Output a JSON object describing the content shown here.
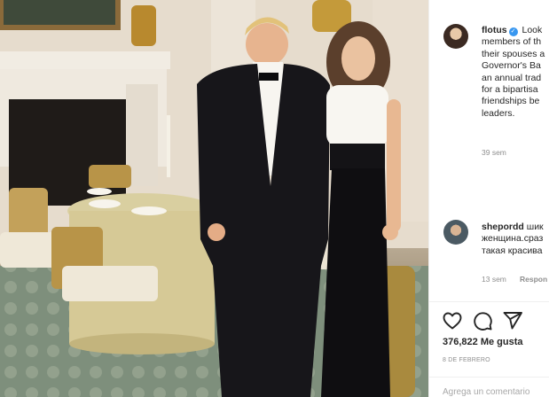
{
  "post": {
    "username": "flotus",
    "caption_lines": [
      "Look",
      "members of th",
      "their spouses a",
      "Governor's Ba",
      "an annual trad",
      "for a bipartisa",
      "friendships be",
      "leaders."
    ],
    "time_ago": "39 sem",
    "verified_icon": "verified-badge-icon"
  },
  "comments": [
    {
      "username": "shepordd",
      "text_first": "шик",
      "text_lines": [
        "женщина.сраз",
        "такая красива"
      ],
      "time_ago": "13 sem",
      "reply_label": "Respon"
    }
  ],
  "actions": {
    "icons": [
      "heart-icon",
      "comment-icon",
      "share-icon"
    ],
    "likes_label": "376,822 Me gusta",
    "date_label": "8 DE FEBRERO"
  },
  "add_comment": {
    "placeholder": "Agrega un comentario"
  },
  "colors": {
    "text": "#262626",
    "muted": "#8e8e8e",
    "verified": "#3897f0",
    "border": "#efefef"
  }
}
